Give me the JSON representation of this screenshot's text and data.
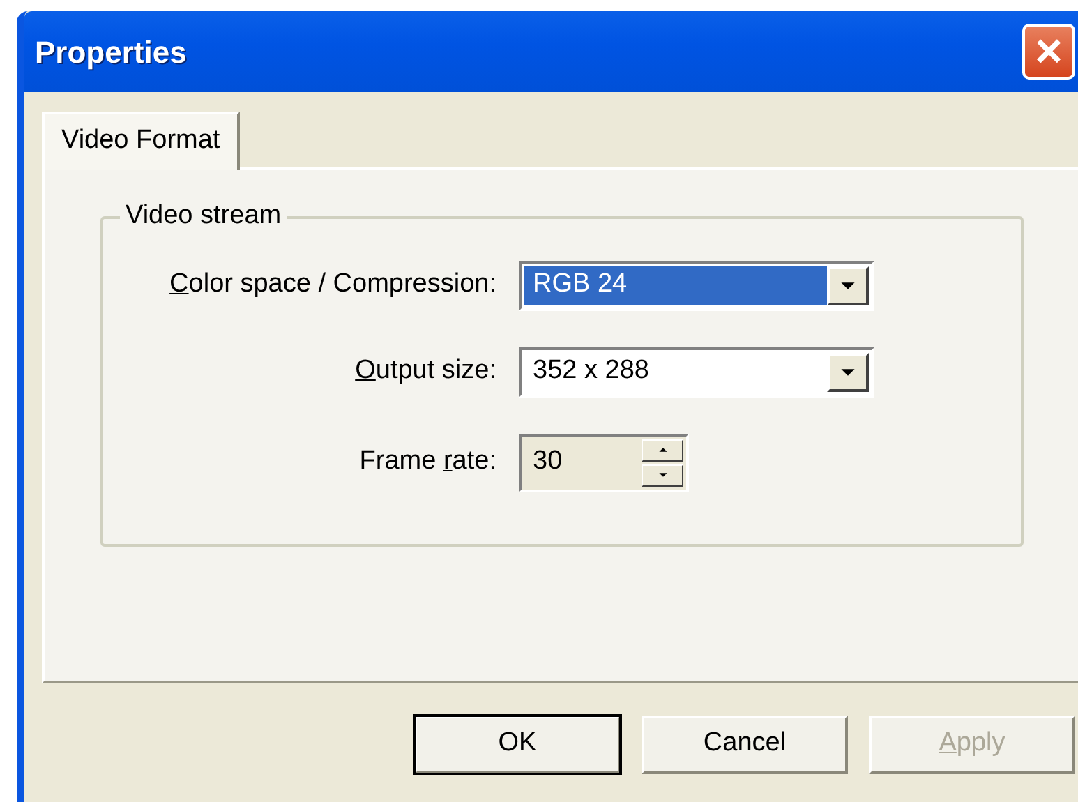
{
  "window": {
    "title": "Properties",
    "close": "×"
  },
  "tabs": [
    {
      "label": "Video Format",
      "selected": true
    }
  ],
  "group": {
    "title": "Video stream"
  },
  "fields": [
    {
      "kind": "combo",
      "accel": "C",
      "label_after": "olor space / Compression:",
      "value": "RGB 24",
      "selected": true
    },
    {
      "kind": "combo",
      "accel": "O",
      "label_after": "utput size:",
      "value": "352 x 288",
      "selected": false
    },
    {
      "kind": "spin",
      "label_before": "Frame ",
      "accel": "r",
      "label_after": "ate:",
      "value": "30",
      "disabled": true
    }
  ],
  "buttons": [
    {
      "label_before": "OK",
      "default": true,
      "disabled": false
    },
    {
      "label_before": "Cancel",
      "default": false,
      "disabled": false
    },
    {
      "accel": "A",
      "label_after": "pply",
      "default": false,
      "disabled": true
    }
  ]
}
